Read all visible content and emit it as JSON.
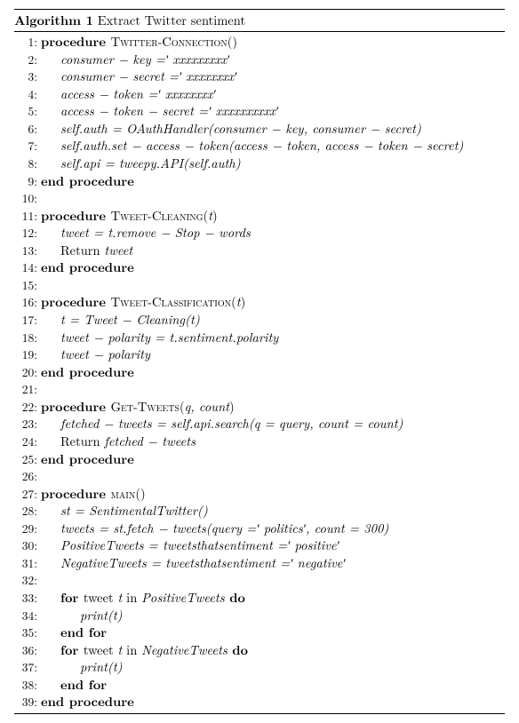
{
  "title_prefix": "Algorithm 1",
  "title_text": "Extract Twitter sentiment",
  "lines": [
    {
      "n": "1:",
      "kw1": "procedure ",
      "proc": "Twitter-Connection",
      "args": "()"
    },
    {
      "n": "2:",
      "ind": "ind1",
      "it": "consumer − key =′ xxxxxxxxx′"
    },
    {
      "n": "3:",
      "ind": "ind1",
      "it": "consumer − secret =′ xxxxxxxx′"
    },
    {
      "n": "4:",
      "ind": "ind1",
      "it": "access − token =′ xxxxxxxx′"
    },
    {
      "n": "5:",
      "ind": "ind1",
      "it": "access − token − secret =′ xxxxxxxxxx′"
    },
    {
      "n": "6:",
      "ind": "ind1",
      "it": "self.auth = OAuthHandler(consumer − key, consumer − secret)"
    },
    {
      "n": "7:",
      "ind": "ind1",
      "it": "self.auth.set − access − token(access − token, access − token − secret)"
    },
    {
      "n": "8:",
      "ind": "ind1",
      "it": "self.api = tweepy.API(self.auth)"
    },
    {
      "n": "9:",
      "kw1": "end procedure"
    },
    {
      "n": "10:"
    },
    {
      "n": "11:",
      "kw1": "procedure ",
      "proc": "Tweet-Cleaning",
      "args": "(",
      "argsit": "t",
      "argsend": ")"
    },
    {
      "n": "12:",
      "ind": "ind1",
      "it": "tweet = t.remove − Stop − words"
    },
    {
      "n": "13:",
      "ind": "ind1",
      "txt": "Return ",
      "it2": "tweet"
    },
    {
      "n": "14:",
      "kw1": "end procedure"
    },
    {
      "n": "15:"
    },
    {
      "n": "16:",
      "kw1": "procedure ",
      "proc": "Tweet-Classification",
      "args": "(",
      "argsit": "t",
      "argsend": ")"
    },
    {
      "n": "17:",
      "ind": "ind1",
      "it": "t = Tweet − Cleaning(t)"
    },
    {
      "n": "18:",
      "ind": "ind1",
      "it": "tweet − polarity = t.sentiment.polarity"
    },
    {
      "n": "19:",
      "ind": "ind1",
      "it": "tweet − polarity"
    },
    {
      "n": "20:",
      "kw1": "end procedure"
    },
    {
      "n": "21:"
    },
    {
      "n": "22:",
      "kw1": "procedure ",
      "proc": "Get-Tweets",
      "args": "(",
      "argsit": "q, count",
      "argsend": ")"
    },
    {
      "n": "23:",
      "ind": "ind1",
      "it": "fetched − tweets = self.api.search(q = query, count = count)"
    },
    {
      "n": "24:",
      "ind": "ind1",
      "txt": "Return ",
      "it2": "fetched − tweets"
    },
    {
      "n": "25:",
      "kw1": "end procedure"
    },
    {
      "n": "26:"
    },
    {
      "n": "27:",
      "kw1": "procedure ",
      "proc": "main",
      "args": "()"
    },
    {
      "n": "28:",
      "ind": "ind1",
      "it": "st = SentimentalTwitter()"
    },
    {
      "n": "29:",
      "ind": "ind1",
      "it": "tweets = st.fetch − tweets(query =′ politics′, count = 300)"
    },
    {
      "n": "30:",
      "ind": "ind1",
      "it": "PositiveTweets = tweetsthatsentiment =′ positive′"
    },
    {
      "n": "31:",
      "ind": "ind1",
      "it": "NegativeTweets = tweetsthatsentiment =′ negative′"
    },
    {
      "n": "32:"
    },
    {
      "n": "33:",
      "ind": "ind1",
      "kw1": "for ",
      "txt2": "tweet ",
      "it2": "t",
      "txt3": " in ",
      "it3": "PositiveTweets",
      "kw2": " do"
    },
    {
      "n": "34:",
      "ind": "ind2",
      "it": "print(t)"
    },
    {
      "n": "35:",
      "ind": "ind1",
      "kw1": "end for"
    },
    {
      "n": "36:",
      "ind": "ind1",
      "kw1": "for ",
      "txt2": "tweet ",
      "it2": "t",
      "txt3": " in ",
      "it3": "NegativeTweets",
      "kw2": " do"
    },
    {
      "n": "37:",
      "ind": "ind2",
      "it": "print(t)"
    },
    {
      "n": "38:",
      "ind": "ind1",
      "kw1": "end for"
    },
    {
      "n": "39:",
      "kw1": "end procedure"
    }
  ]
}
